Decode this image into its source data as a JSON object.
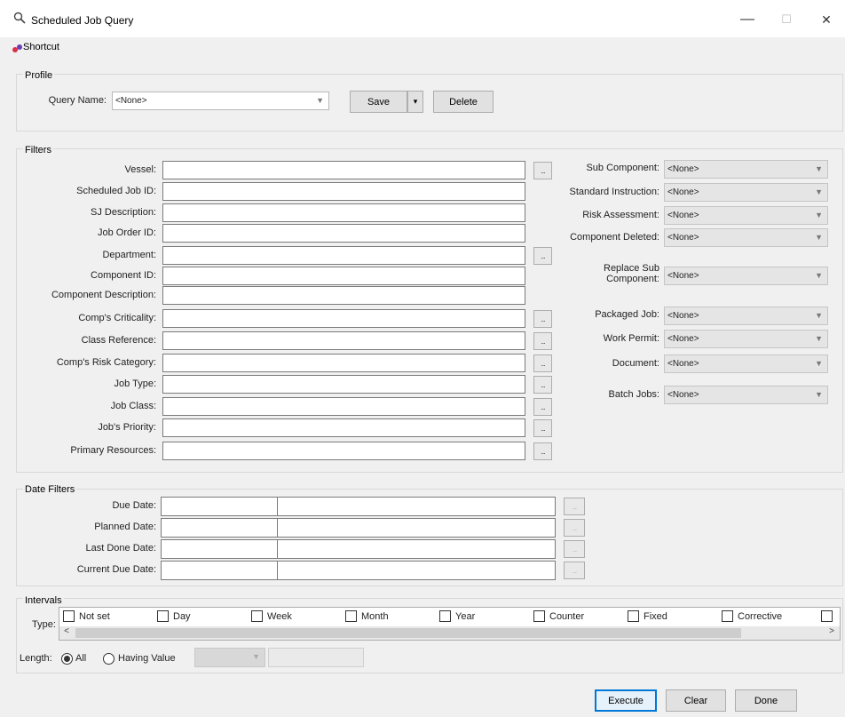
{
  "window": {
    "title": "Scheduled Job Query",
    "minimize": "—",
    "maximize": "☐",
    "close": "✕"
  },
  "toolbar": {
    "shortcut_label": "Shortcut"
  },
  "profile": {
    "group_label": "Profile",
    "query_name_label": "Query Name:",
    "query_name_value": "<None>",
    "save_label": "Save",
    "save_dropdown": "▾",
    "delete_label": "Delete"
  },
  "filters": {
    "group_label": "Filters",
    "left": [
      {
        "label": "Vessel:",
        "value": "",
        "has_button": true
      },
      {
        "label": "Scheduled Job ID:",
        "value": "",
        "has_button": false
      },
      {
        "label": "SJ Description:",
        "value": "",
        "has_button": false
      },
      {
        "label": "Job Order ID:",
        "value": "",
        "has_button": false
      },
      {
        "label": "Department:",
        "value": "",
        "has_button": true
      },
      {
        "label": "Component ID:",
        "value": "",
        "has_button": false
      },
      {
        "label": "Component Description:",
        "value": "",
        "has_button": false
      },
      {
        "label": "Comp's Criticality:",
        "value": "",
        "has_button": true
      },
      {
        "label": "Class Reference:",
        "value": "",
        "has_button": true
      },
      {
        "label": "Comp's Risk Category:",
        "value": "",
        "has_button": true
      },
      {
        "label": "Job Type:",
        "value": "",
        "has_button": true
      },
      {
        "label": "Job Class:",
        "value": "",
        "has_button": true
      },
      {
        "label": "Job's Priority:",
        "value": "",
        "has_button": true
      },
      {
        "label": "Primary Resources:",
        "value": "",
        "has_button": true
      }
    ],
    "ellipsis": "...",
    "right": [
      {
        "label": "Sub Component:",
        "value": "<None>"
      },
      {
        "label": "Standard Instruction:",
        "value": "<None>"
      },
      {
        "label": "Risk Assessment:",
        "value": "<None>"
      },
      {
        "label": "Component Deleted:",
        "value": "<None>"
      },
      {
        "label": "Replace Sub Component:",
        "value": "<None>"
      },
      {
        "label": "Packaged Job:",
        "value": "<None>"
      },
      {
        "label": "Work Permit:",
        "value": "<None>"
      },
      {
        "label": "Document:",
        "value": "<None>"
      },
      {
        "label": "Batch Jobs:",
        "value": "<None>"
      }
    ]
  },
  "date_filters": {
    "group_label": "Date Filters",
    "rows": [
      {
        "label": "Due Date:"
      },
      {
        "label": "Planned Date:"
      },
      {
        "label": "Last Done Date:"
      },
      {
        "label": "Current Due Date:"
      }
    ]
  },
  "intervals": {
    "group_label": "Intervals",
    "type_label": "Type:",
    "types": [
      "Not set",
      "Day",
      "Week",
      "Month",
      "Year",
      "Counter",
      "Fixed",
      "Corrective"
    ],
    "scroll_left": "<",
    "scroll_right": ">",
    "length_label": "Length:",
    "all_label": "All",
    "having_value_label": "Having Value"
  },
  "footer": {
    "execute_label": "Execute",
    "clear_label": "Clear",
    "done_label": "Done"
  }
}
